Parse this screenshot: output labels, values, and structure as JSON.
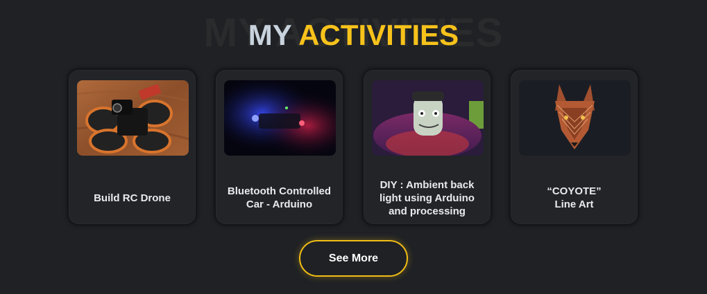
{
  "header": {
    "title_shadow": "MY ACTIVITIES",
    "title_part1": "MY",
    "title_part2": "ACTIVITIES"
  },
  "activities": [
    {
      "label": "Build RC Drone",
      "image_name": "rc-drone-image"
    },
    {
      "label": "Bluetooth Controlled\nCar - Arduino",
      "image_name": "bluetooth-car-image"
    },
    {
      "label": "DIY : Ambient back\nlight using Arduino\nand processing",
      "image_name": "ambient-backlight-image"
    },
    {
      "label": "“COYOTE”\nLine Art",
      "image_name": "coyote-line-art-image"
    }
  ],
  "see_more": {
    "label": "See More"
  },
  "colors": {
    "background": "#1f2125",
    "accent": "#f7c21b",
    "title_light": "#c9d3de"
  }
}
